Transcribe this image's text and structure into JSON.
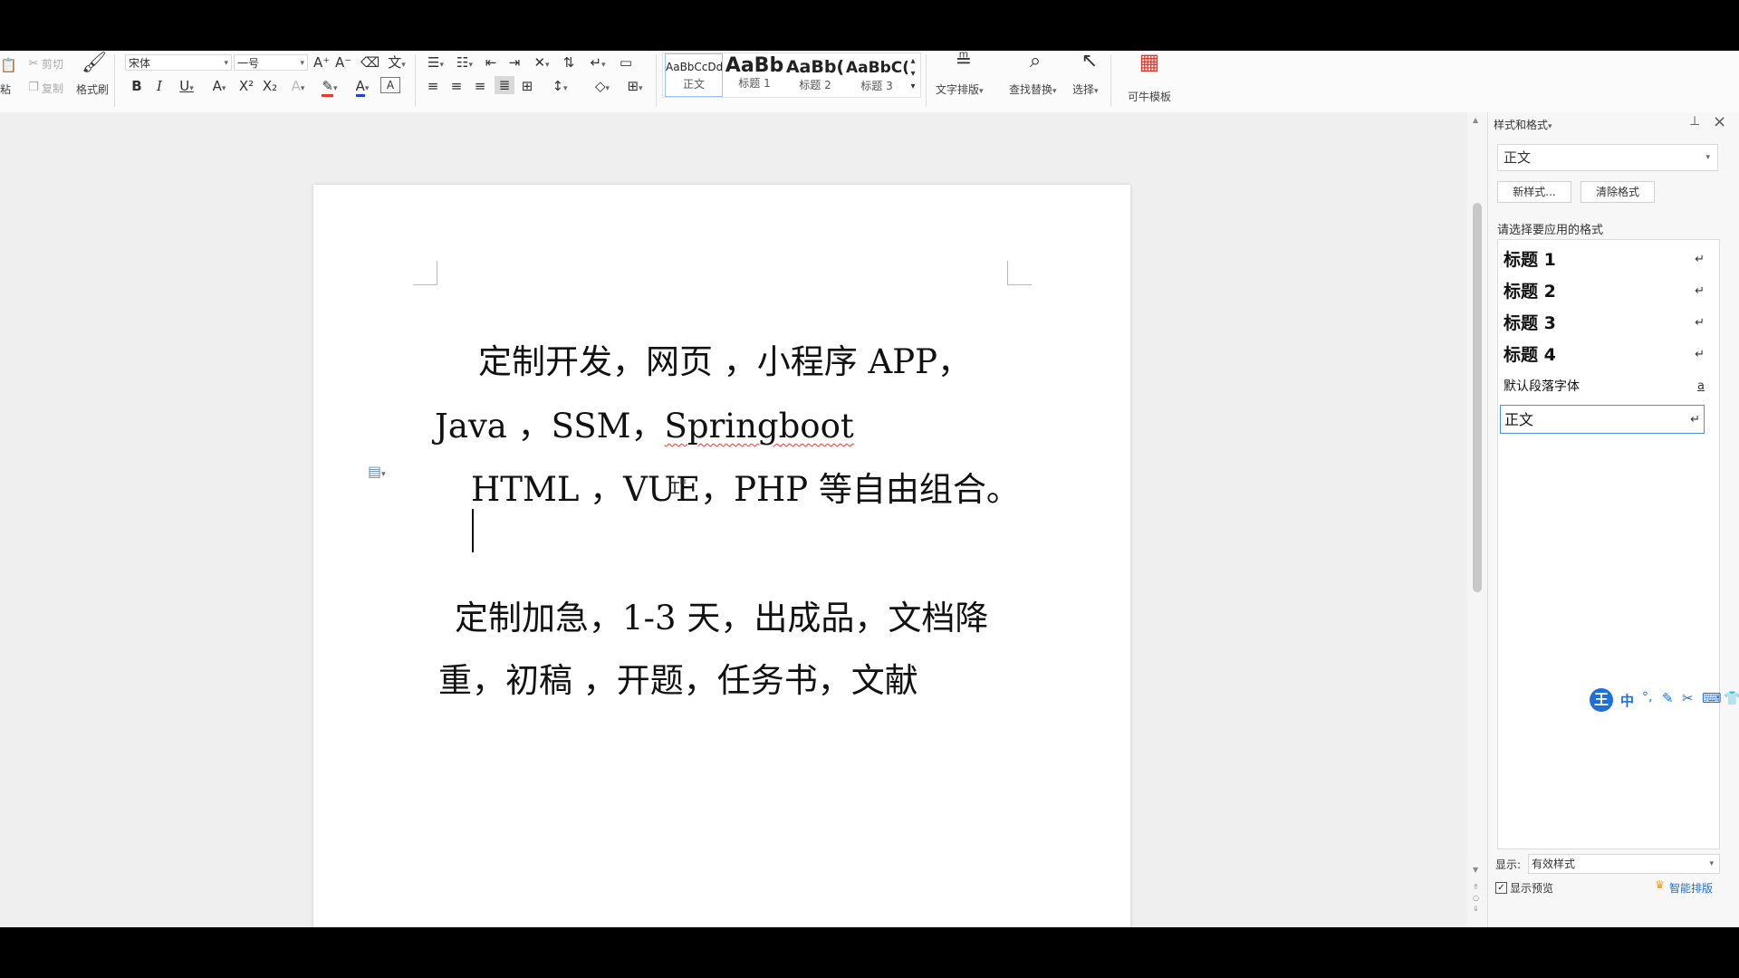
{
  "ribbon": {
    "clipboard": {
      "cut": "剪切",
      "copy": "复制",
      "paste_partial": "粘",
      "format_painter": "格式刷"
    },
    "font": {
      "name": "宋体",
      "size": "一号"
    },
    "style_gallery": [
      {
        "preview": "AaBbCcDd",
        "name": "正文"
      },
      {
        "preview": "AaBb",
        "name": "标题 1"
      },
      {
        "preview": "AaBb(",
        "name": "标题 2"
      },
      {
        "preview": "AaBbC(",
        "name": "标题 3"
      }
    ],
    "text_layout": "文字排版",
    "find_replace": "查找替换",
    "select": "选择",
    "template": "可牛模板"
  },
  "document": {
    "line1": "定制开发，网页 ，小程序 APP，",
    "line2a": "Java ，SSM，",
    "line2b": "Springboot",
    "line3": "HTML ，VUE，PHP 等自由组合。",
    "line5": "定制加急，1-3 天，出成品，文档降",
    "line6": "重，初稿 ，开题，任务书，文献"
  },
  "styles_pane": {
    "title": "样式和格式",
    "current_style": "正文",
    "new_style": "新样式...",
    "clear_format": "清除格式",
    "prompt": "请选择要应用的格式",
    "items": [
      {
        "label": "标题 1",
        "mark": "↵"
      },
      {
        "label": "标题 2",
        "mark": "↵"
      },
      {
        "label": "标题 3",
        "mark": "↵"
      },
      {
        "label": "标题 4",
        "mark": "↵"
      },
      {
        "label": "默认段落字体",
        "mark": "a"
      },
      {
        "label": "正文",
        "mark": "↵"
      }
    ],
    "show_label": "显示:",
    "show_value": "有效样式",
    "show_preview": "显示预览",
    "smart_layout": "智能排版"
  },
  "ime": {
    "logo": "王",
    "mode": "中"
  },
  "colors": {
    "accent": "#1e6fd9",
    "highlight": "#e8382c",
    "font_color": "#2a3fd0",
    "smart": "#1e6fd9"
  }
}
